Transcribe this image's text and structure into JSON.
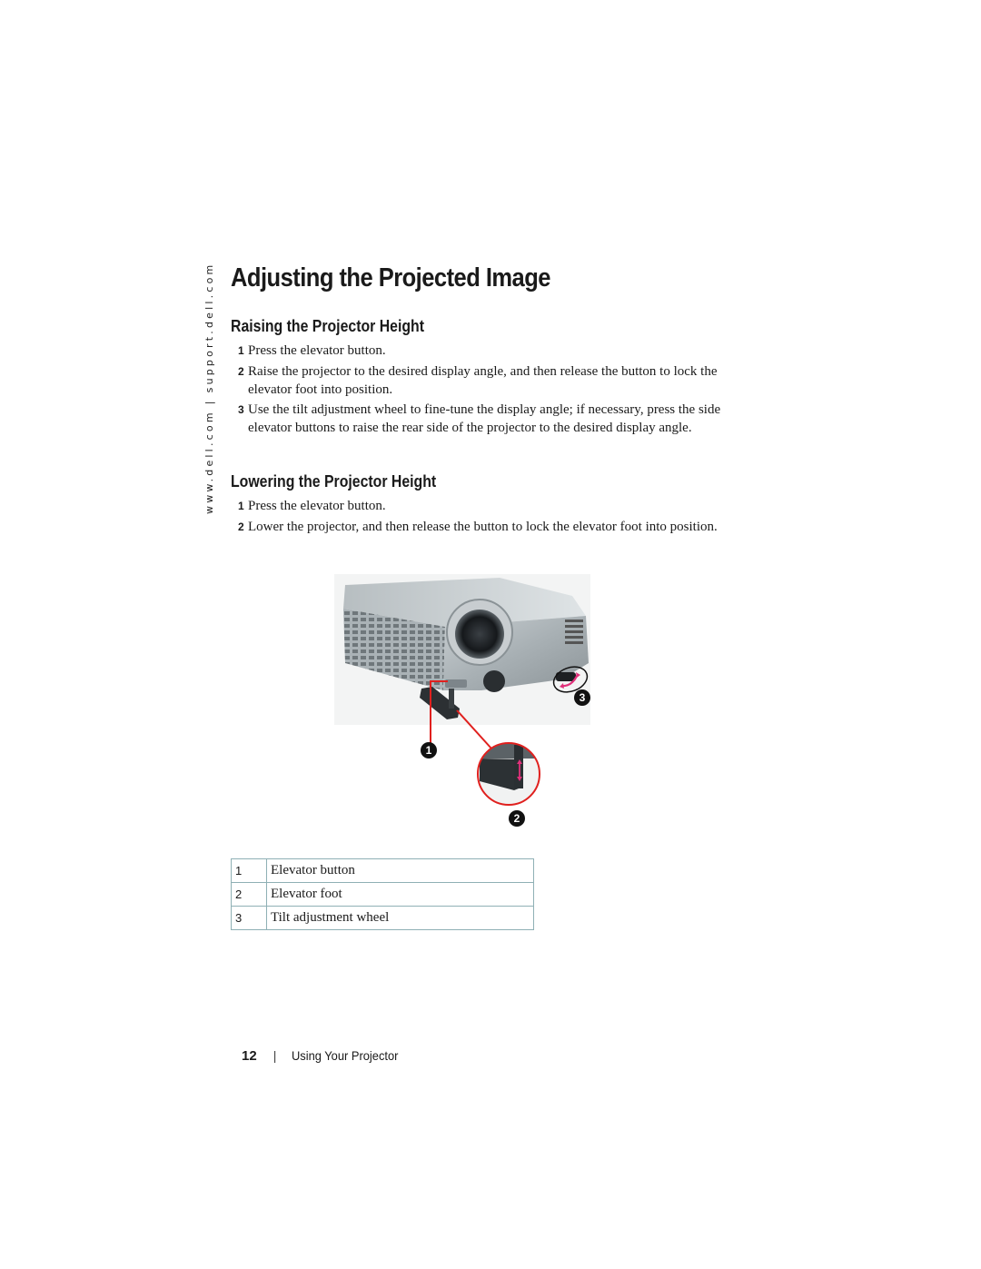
{
  "side_url": {
    "left": "www.dell.com",
    "separator": "|",
    "right": "support.dell.com"
  },
  "page_title": "Adjusting the Projected Image",
  "sections": [
    {
      "heading": "Raising the Projector Height",
      "steps": [
        {
          "num": "1",
          "text": "Press the elevator button."
        },
        {
          "num": "2",
          "text": "Raise the projector to the desired display angle, and then release the button to lock the elevator foot into position."
        },
        {
          "num": "3",
          "text": "Use the tilt adjustment wheel to fine-tune the display angle; if necessary, press the side elevator buttons to raise the rear side of the projector to the desired display angle."
        }
      ]
    },
    {
      "heading": "Lowering the Projector Height",
      "steps": [
        {
          "num": "1",
          "text": "Press the elevator button."
        },
        {
          "num": "2",
          "text": "Lower the projector, and then release the button to lock the elevator foot into position."
        }
      ]
    }
  ],
  "figure": {
    "callouts": [
      "1",
      "2",
      "3"
    ],
    "accent_color": "#e0201e",
    "arrow_color": "#e0307a"
  },
  "legend": [
    {
      "num": "1",
      "label": "Elevator button"
    },
    {
      "num": "2",
      "label": "Elevator foot"
    },
    {
      "num": "3",
      "label": "Tilt adjustment wheel"
    }
  ],
  "footer": {
    "page_number": "12",
    "separator": "|",
    "chapter": "Using Your Projector"
  }
}
